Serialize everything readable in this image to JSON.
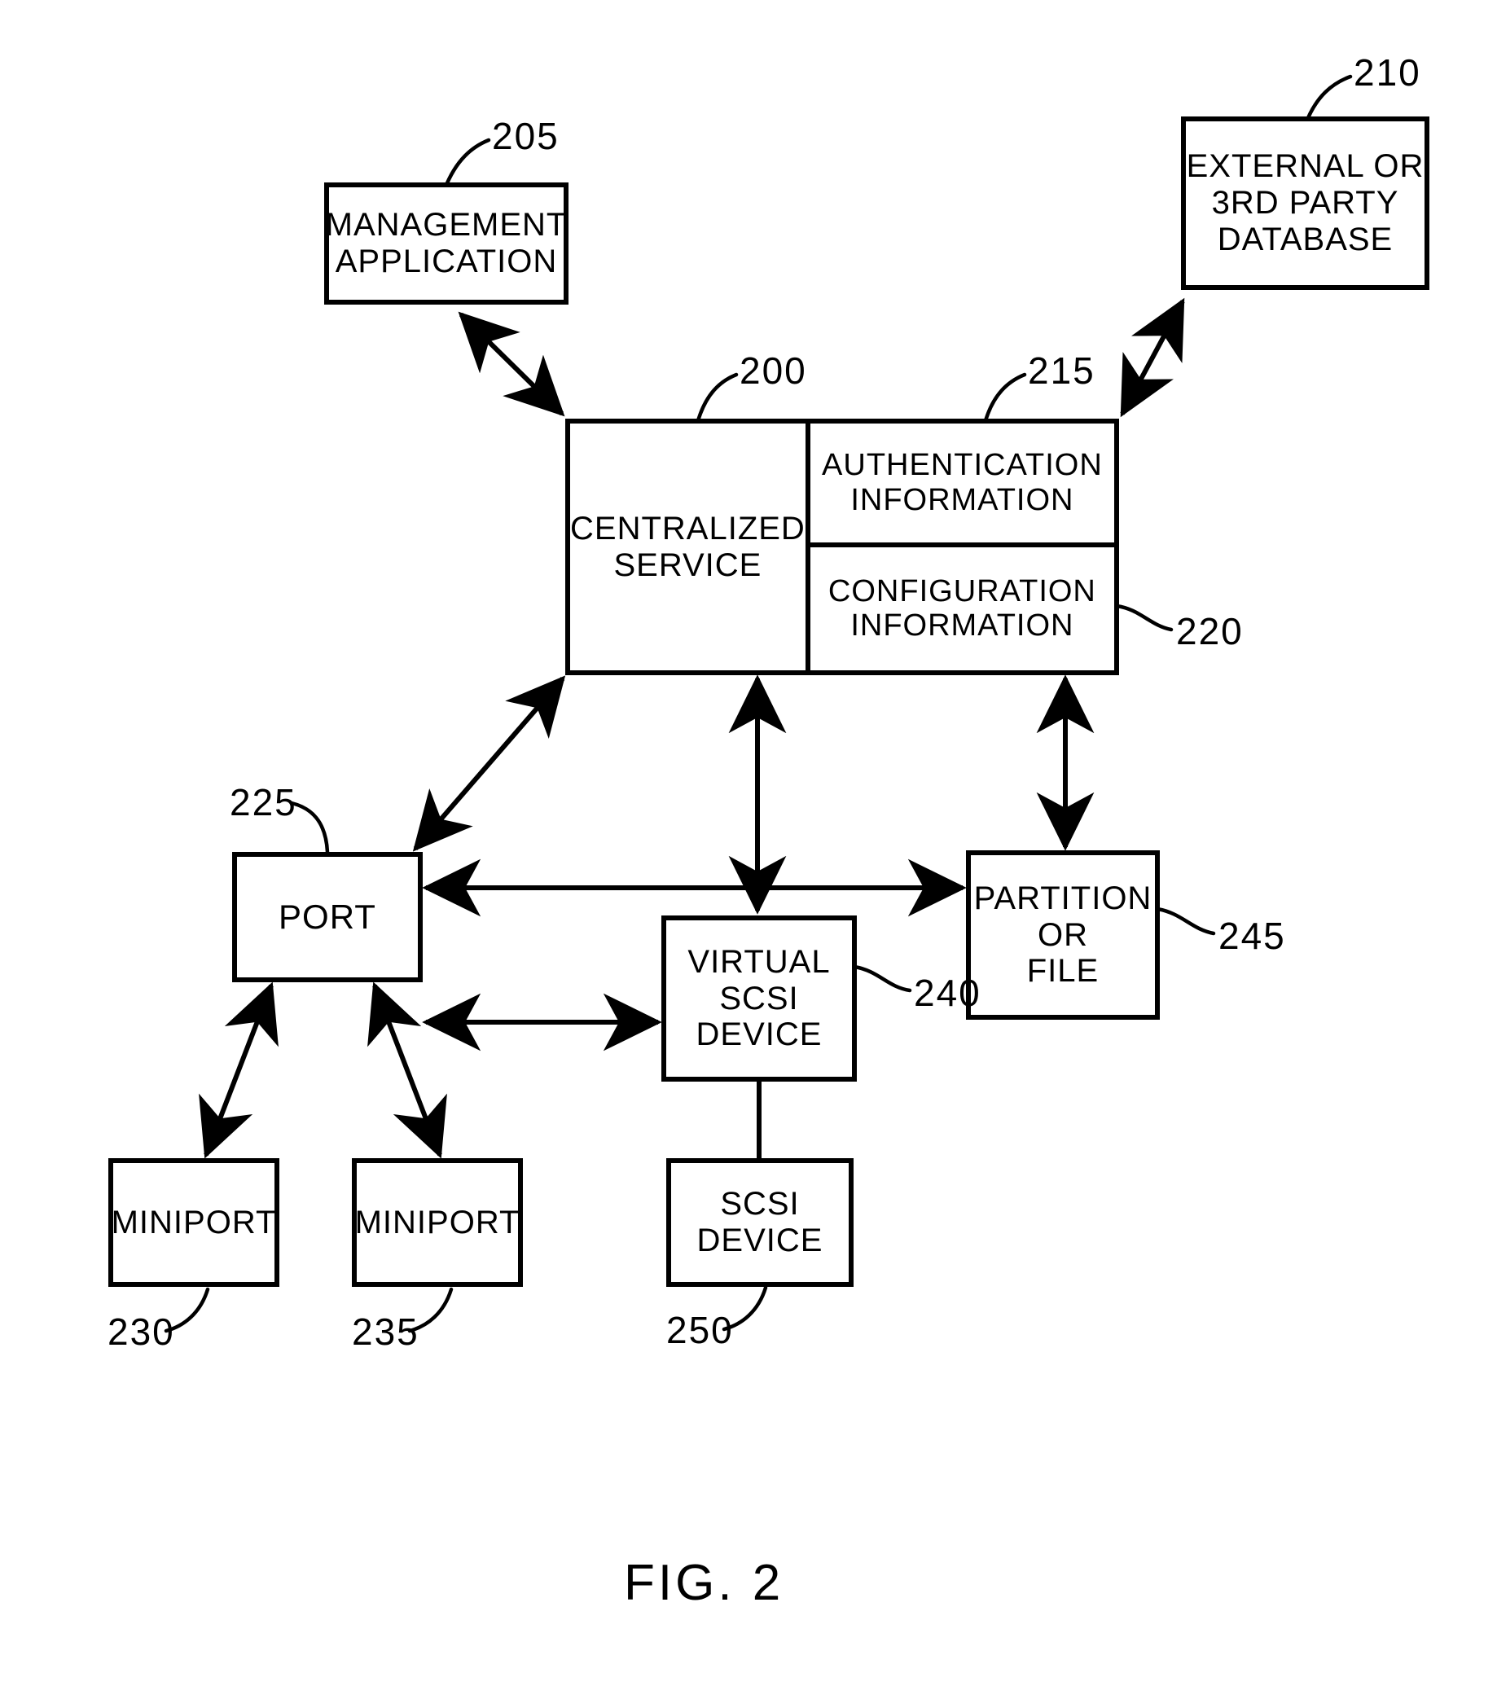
{
  "figure": {
    "caption": "FIG. 2",
    "title": "FIG. 2"
  },
  "nodes": {
    "management_application": {
      "label_line1": "MANAGEMENT",
      "label_line2": "APPLICATION",
      "ref": "205"
    },
    "external_database": {
      "label_line1": "EXTERNAL OR",
      "label_line2": "3RD PARTY",
      "label_line3": "DATABASE",
      "ref": "210"
    },
    "centralized_service": {
      "label_line1": "CENTRALIZED",
      "label_line2": "SERVICE",
      "ref": "200"
    },
    "authentication_information": {
      "label_line1": "AUTHENTICATION",
      "label_line2": "INFORMATION",
      "ref": "215"
    },
    "configuration_information": {
      "label_line1": "CONFIGURATION",
      "label_line2": "INFORMATION",
      "ref": "220"
    },
    "port": {
      "label_line1": "PORT",
      "ref": "225"
    },
    "miniport_left": {
      "label_line1": "MINIPORT",
      "ref": "230"
    },
    "miniport_right": {
      "label_line1": "MINIPORT",
      "ref": "235"
    },
    "virtual_scsi_device": {
      "label_line1": "VIRTUAL",
      "label_line2": "SCSI",
      "label_line3": "DEVICE",
      "ref": "240"
    },
    "partition_or_file": {
      "label_line1": "PARTITION",
      "label_line2": "OR",
      "label_line3": "FILE",
      "ref": "245"
    },
    "scsi_device": {
      "label_line1": "SCSI",
      "label_line2": "DEVICE",
      "ref": "250"
    }
  },
  "connections": [
    {
      "from": "management_application",
      "to": "centralized_service",
      "style": "double-arrow-diagonal"
    },
    {
      "from": "centralized_service",
      "to": "external_database",
      "style": "double-arrow-diagonal"
    },
    {
      "from": "centralized_service",
      "to": "port",
      "style": "double-arrow-diagonal"
    },
    {
      "from": "centralized_service",
      "to": "virtual_scsi_device",
      "style": "double-arrow-vertical"
    },
    {
      "from": "configuration_information",
      "to": "partition_or_file",
      "style": "double-arrow-vertical"
    },
    {
      "from": "port",
      "to": "partition_or_file",
      "style": "double-arrow-horizontal"
    },
    {
      "from": "port",
      "to": "virtual_scsi_device",
      "style": "double-arrow-horizontal"
    },
    {
      "from": "port",
      "to": "miniport_left",
      "style": "double-arrow-diagonal"
    },
    {
      "from": "port",
      "to": "miniport_right",
      "style": "double-arrow-diagonal"
    },
    {
      "from": "virtual_scsi_device",
      "to": "scsi_device",
      "style": "plain-line"
    }
  ],
  "colors": {
    "ink": "#000000",
    "paper": "#ffffff"
  }
}
